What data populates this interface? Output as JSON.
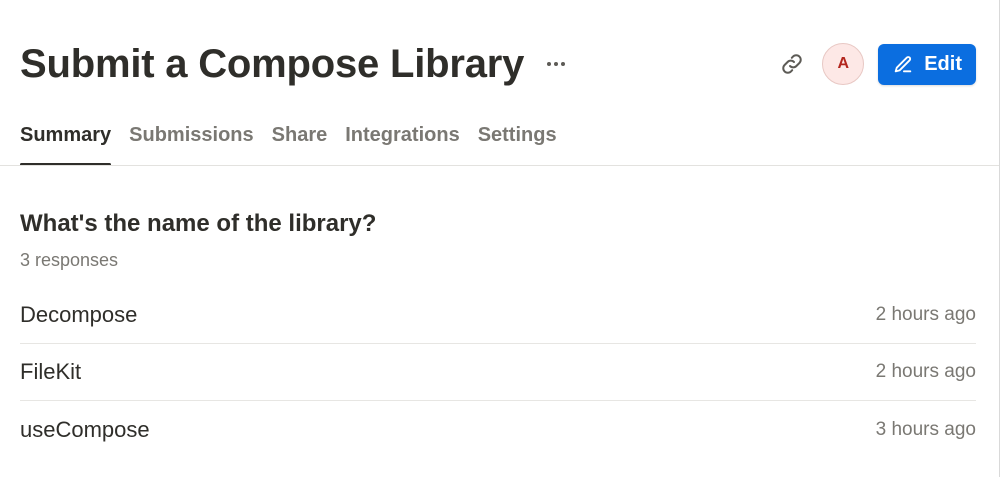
{
  "form": {
    "title": "Submit a Compose Library"
  },
  "header": {
    "more_icon": "more-horizontal-icon",
    "link_icon": "link-icon",
    "avatar_initial": "A",
    "edit_label": "Edit",
    "edit_icon": "pencil-icon",
    "accent_color": "#0b6ee0"
  },
  "tabs": [
    {
      "label": "Summary",
      "active": true
    },
    {
      "label": "Submissions",
      "active": false
    },
    {
      "label": "Share",
      "active": false
    },
    {
      "label": "Integrations",
      "active": false
    },
    {
      "label": "Settings",
      "active": false
    }
  ],
  "summary": {
    "question": "What's the name of the library?",
    "response_count": "3 responses",
    "responses": [
      {
        "value": "Decompose",
        "time": "2 hours ago"
      },
      {
        "value": "FileKit",
        "time": "2 hours ago"
      },
      {
        "value": "useCompose",
        "time": "3 hours ago"
      }
    ]
  }
}
